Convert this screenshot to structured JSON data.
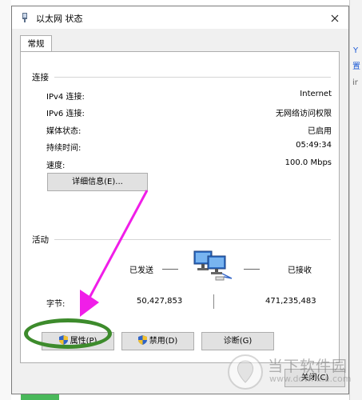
{
  "window": {
    "title": "以太网 状态"
  },
  "tabs": {
    "general": "常规"
  },
  "connection": {
    "group_label": "连接",
    "rows": [
      {
        "label": "IPv4 连接:",
        "value": "Internet"
      },
      {
        "label": "IPv6 连接:",
        "value": "无网络访问权限"
      },
      {
        "label": "媒体状态:",
        "value": "已启用"
      },
      {
        "label": "持续时间:",
        "value": "05:49:34"
      },
      {
        "label": "速度:",
        "value": "100.0 Mbps"
      }
    ],
    "details_button": "详细信息(E)..."
  },
  "activity": {
    "group_label": "活动",
    "sent_label": "已发送",
    "received_label": "已接收",
    "bytes_label": "字节:",
    "sent_bytes": "50,427,853",
    "received_bytes": "471,235,483"
  },
  "buttons": {
    "properties": "属性(P)",
    "disable": "禁用(D)",
    "diagnose": "诊断(G)",
    "close": "关闭(C)"
  },
  "background": {
    "edge_text_1": "Y",
    "edge_text_2": "置",
    "edge_text_3": "ir"
  },
  "watermark": {
    "text": "当下软件园",
    "url": "www.downxia.com"
  },
  "colors": {
    "accent_arrow": "#f01ee8",
    "highlight_ellipse": "#3d8b2c"
  }
}
